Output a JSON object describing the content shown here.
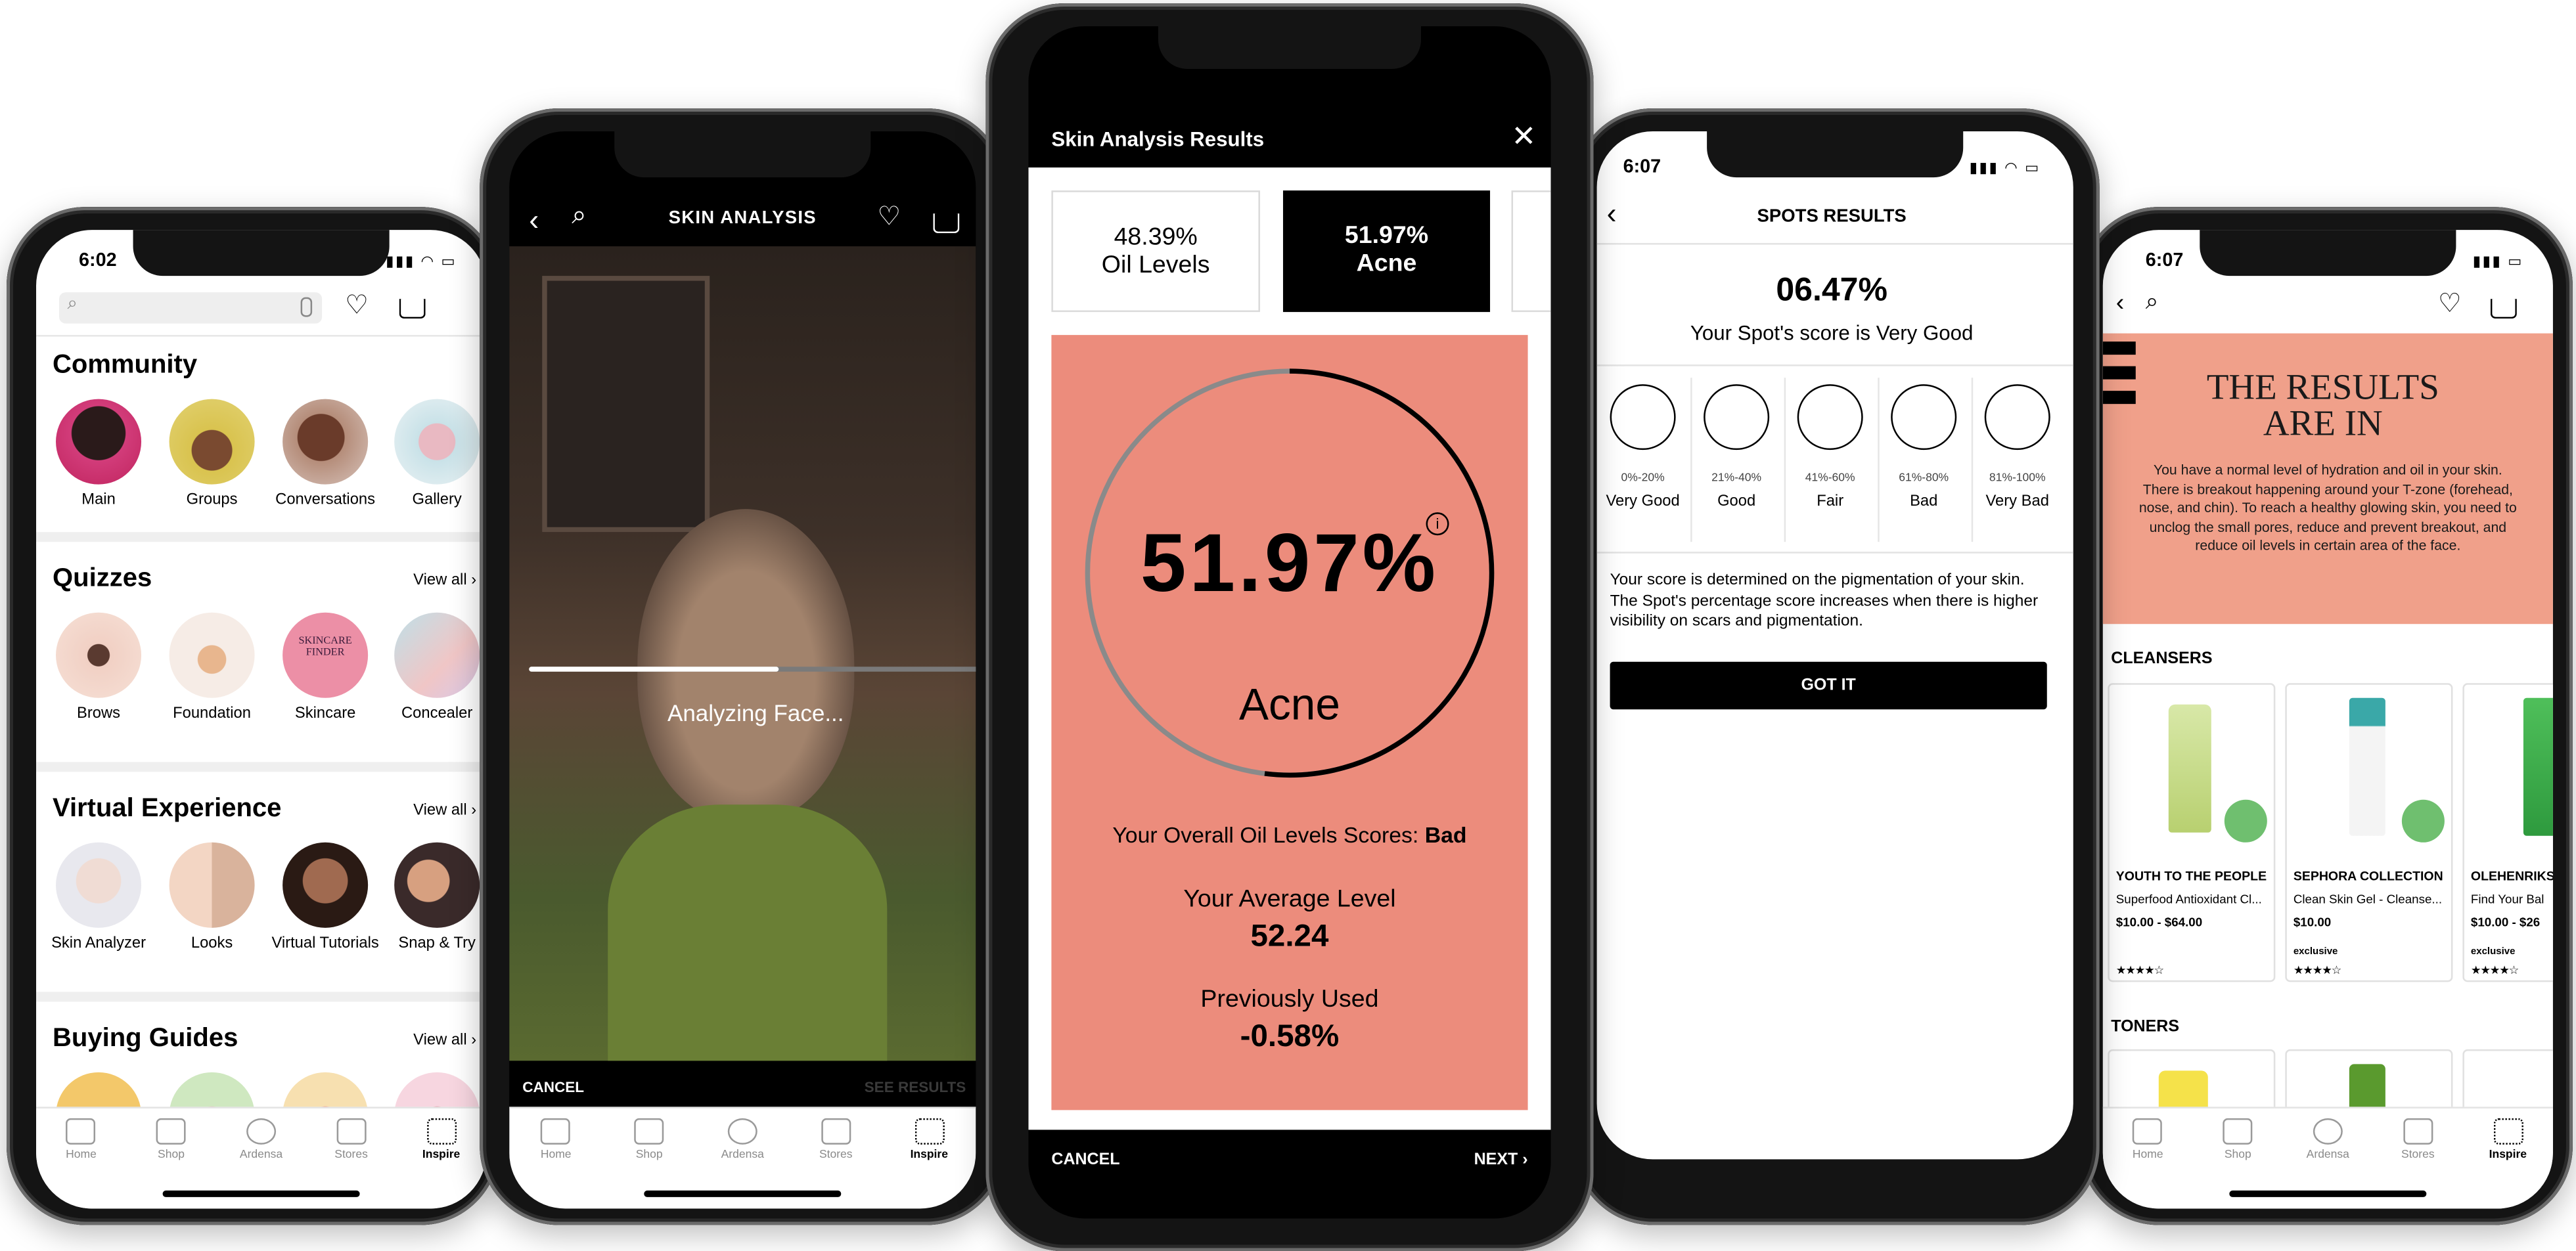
{
  "phone1": {
    "time": "6:02",
    "community": {
      "title": "Community",
      "items": [
        "Main",
        "Groups",
        "Conversations",
        "Gallery"
      ]
    },
    "quizzes": {
      "title": "Quizzes",
      "view_all": "View all",
      "items": [
        "Brows",
        "Foundation",
        "Skincare",
        "Concealer"
      ]
    },
    "virtual": {
      "title": "Virtual Experience",
      "view_all": "View all",
      "items": [
        "Skin Analyzer",
        "Looks",
        "Virtual Tutorials",
        "Snap & Try"
      ]
    },
    "guides": {
      "title": "Buying Guides",
      "view_all": "View all"
    }
  },
  "tabbar": [
    "Home",
    "Shop",
    "Ardensa",
    "Stores",
    "Inspire"
  ],
  "phone2": {
    "title": "SKIN ANALYSIS",
    "status": "Analyzing Face...",
    "progress": 0.55,
    "cancel": "CANCEL",
    "see_results": "SEE RESULTS"
  },
  "phone3": {
    "title": "Skin Analysis Results",
    "cards": [
      {
        "value": "48.39%",
        "label": "Oil Levels"
      },
      {
        "value": "51.97%",
        "label": "Acne"
      }
    ],
    "gauge_value": "51.97%",
    "gauge_fraction": 0.5197,
    "gauge_label": "Acne",
    "overall_prefix": "Your Overall Oil Levels Scores:",
    "overall_rating": "Bad",
    "average_label": "Your Average Level",
    "average_value": "52.24",
    "previous_label": "Previously Used",
    "previous_value": "-0.58%",
    "cancel": "CANCEL",
    "next": "NEXT"
  },
  "phone4": {
    "time": "6:07",
    "title": "SPOTS RESULTS",
    "score": "06.47%",
    "score_text": "Your Spot's score is Very Good",
    "ranges": [
      {
        "range": "0%-20%",
        "label": "Very Good"
      },
      {
        "range": "21%-40%",
        "label": "Good"
      },
      {
        "range": "41%-60%",
        "label": "Fair"
      },
      {
        "range": "61%-80%",
        "label": "Bad"
      },
      {
        "range": "81%-100%",
        "label": "Very Bad"
      }
    ],
    "description": "Your score is determined on the pigmentation of your skin. The Spot's percentage score increases when there is higher visibility on scars and pigmentation.",
    "got_it": "GOT IT"
  },
  "phone5": {
    "time": "6:07",
    "banner_title": "THE RESULTS ARE IN",
    "banner_text": "You have a normal level of hydration and oil in your skin. There is breakout happening around your T-zone (forehead, nose, and chin). To reach a healthy glowing skin, you need to unclog the small pores, reduce and prevent breakout, and reduce oil levels in certain area of the face.",
    "cleansers_title": "CLEANSERS",
    "products": [
      {
        "brand": "YOUTH TO THE PEOPLE",
        "name": "Superfood Antioxidant Cl...",
        "price": "$10.00 - $64.00",
        "exclusive": "",
        "stars": "★★★★☆"
      },
      {
        "brand": "SEPHORA COLLECTION",
        "name": "Clean Skin Gel - Cleanse...",
        "price": "$10.00",
        "exclusive": "exclusive",
        "stars": "★★★★☆"
      },
      {
        "brand": "OLEHENRIKS",
        "name": "Find Your Bal",
        "price": "$10.00 - $26",
        "exclusive": "exclusive",
        "stars": "★★★★☆"
      }
    ],
    "toners_title": "TONERS"
  }
}
